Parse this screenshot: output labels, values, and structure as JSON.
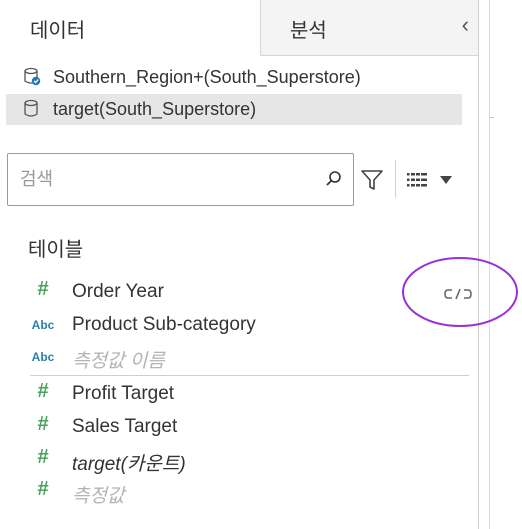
{
  "tabs": {
    "data_label": "데이터",
    "analysis_label": "분석",
    "collapse_symbol": "‹"
  },
  "datasources": [
    {
      "label": "Southern_Region+(South_Superstore)",
      "selected": false,
      "icon": "database-check-icon"
    },
    {
      "label": "target(South_Superstore)",
      "selected": true,
      "icon": "database-icon"
    }
  ],
  "search": {
    "placeholder": "검색",
    "value": ""
  },
  "section": {
    "title": "테이블"
  },
  "fields_group1": [
    {
      "type_symbol": "#",
      "type": "number",
      "label": "Order Year",
      "style": "normal"
    },
    {
      "type_symbol": "Abc",
      "type": "string",
      "label": "Product Sub-category",
      "style": "normal"
    },
    {
      "type_symbol": "Abc",
      "type": "string",
      "label": "측정값 이름",
      "style": "muted"
    }
  ],
  "fields_group2": [
    {
      "type_symbol": "#",
      "type": "number",
      "label": "Profit Target",
      "style": "normal"
    },
    {
      "type_symbol": "#",
      "type": "number",
      "label": "Sales Target",
      "style": "normal"
    },
    {
      "type_symbol": "#",
      "type": "number",
      "label": "target(카운트)",
      "style": "italic"
    },
    {
      "type_symbol": "#",
      "type": "number",
      "label": "측정값",
      "style": "muted"
    }
  ],
  "colors": {
    "number": "#4aa35a",
    "string": "#2e7fa8",
    "annotation": "#9b30d9",
    "selected_bg": "#e6e6e6"
  }
}
